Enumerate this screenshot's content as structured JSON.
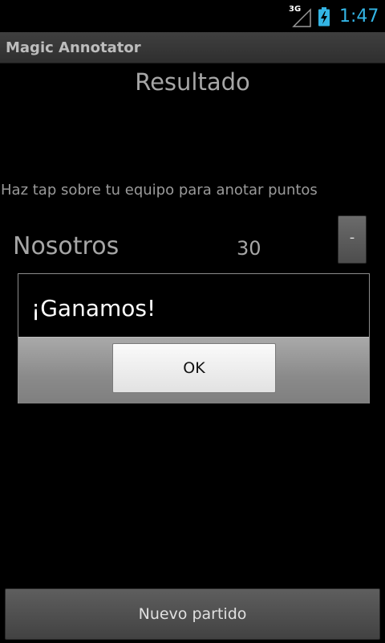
{
  "status_bar": {
    "network_type": "3G",
    "signal_icon": "signal-strength-icon",
    "battery_icon": "battery-charging-icon",
    "time": "1:47",
    "accent_color": "#33b5e5"
  },
  "app": {
    "title": "Magic Annotator"
  },
  "main": {
    "heading": "Resultado",
    "instructions": "Haz tap sobre tu equipo para anotar puntos",
    "team": {
      "name": "Nosotros",
      "score": "30",
      "minus_label": "-"
    },
    "new_game_label": "Nuevo partido"
  },
  "dialog": {
    "message": "¡Ganamos!",
    "ok_label": "OK"
  }
}
